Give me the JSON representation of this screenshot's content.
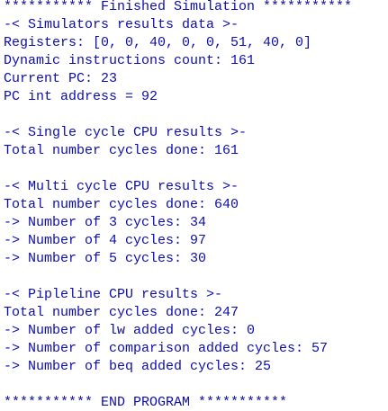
{
  "console": {
    "text_color": "#0c0cb4",
    "background": "#ffffff",
    "lines": [
      "*********** Finished Simulation ***********",
      "-< Simulators results data >-",
      "Registers: [0, 0, 40, 0, 0, 51, 40, 0]",
      "Dynamic instructions count: 161",
      "Current PC: 23",
      "PC int address = 92",
      "",
      "-< Single cycle CPU results >-",
      "Total number cycles done: 161",
      "",
      "-< Multi cycle CPU results >-",
      "Total number cycles done: 640",
      "-> Number of 3 cycles: 34",
      "-> Number of 4 cycles: 97",
      "-> Number of 5 cycles: 30",
      "",
      "-< Pipleline CPU results >-",
      "Total number cycles done: 247",
      "-> Number of lw added cycles: 0",
      "-> Number of comparison added cycles: 57",
      "-> Number of beq added cycles: 25",
      "",
      "*********** END PROGRAM ***********"
    ]
  }
}
